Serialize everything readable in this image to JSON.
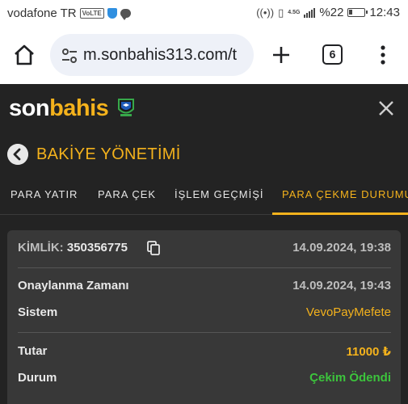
{
  "status_bar": {
    "carrier": "vodafone TR",
    "volte": "VoLTE",
    "network": "4.5G",
    "battery": "%22",
    "time": "12:43"
  },
  "browser": {
    "url": "m.sonbahis313.com/t",
    "tab_count": "6"
  },
  "site": {
    "logo_part1": "son",
    "logo_part2": "bahis",
    "brand_color": "#f4b21c"
  },
  "page": {
    "title": "BAKİYE YÖNETİMİ",
    "tabs": [
      {
        "label": "PARA YATIR"
      },
      {
        "label": "PARA ÇEK"
      },
      {
        "label": "İŞLEM GEÇMİŞİ"
      },
      {
        "label": "PARA ÇEKME DURUMU"
      }
    ],
    "active_tab": 3
  },
  "withdrawal": {
    "id_label": "KİMLİK:",
    "id_value": "350356775",
    "created": "14.09.2024, 19:38",
    "approval_label": "Onaylanma Zamanı",
    "approval_value": "14.09.2024, 19:43",
    "system_label": "Sistem",
    "system_value": "VevoPayMefete",
    "amount_label": "Tutar",
    "amount_value": "11000 ₺",
    "status_label": "Durum",
    "status_value": "Çekim Ödendi",
    "colors": {
      "system": "#f4b21c",
      "amount": "#f4b21c",
      "status": "#3cc43c"
    }
  }
}
